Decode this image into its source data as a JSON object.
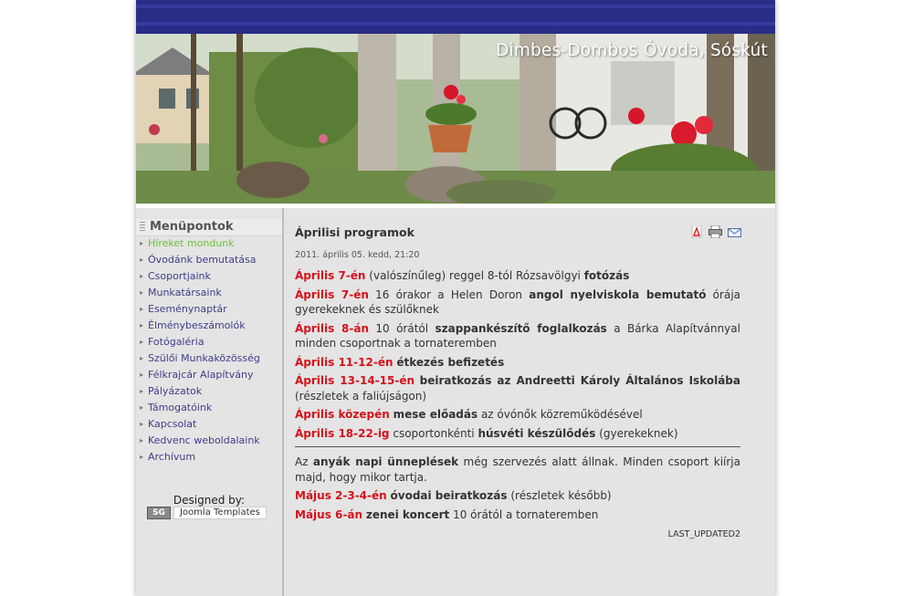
{
  "header": {
    "site_title": "Dimbes-Dombos Óvoda, Sóskút"
  },
  "sidebar": {
    "title": "Menüpontok",
    "items": [
      {
        "label": "Híreket mondunk",
        "active": true
      },
      {
        "label": "Óvodánk bemutatása"
      },
      {
        "label": "Csoportjaink"
      },
      {
        "label": "Munkatársaink"
      },
      {
        "label": "Eseménynaptár"
      },
      {
        "label": "Élménybeszámolók"
      },
      {
        "label": "Fotógaléria"
      },
      {
        "label": "Szülői Munkaközösség"
      },
      {
        "label": "Félkrajcár Alapítvány"
      },
      {
        "label": "Pályázatok"
      },
      {
        "label": "Támogatóink"
      },
      {
        "label": "Kapcsolat"
      },
      {
        "label": "Kedvenc weboldalaink"
      },
      {
        "label": "Archívum"
      }
    ],
    "designed_by": "Designed by:",
    "badge_logo": "SG",
    "badge_label": "Joomla Templates"
  },
  "article": {
    "title": "Áprilisi programok",
    "date": "2011. április 05. kedd, 21:20",
    "icons": [
      "pdf-icon",
      "print-icon",
      "email-icon"
    ],
    "p1": {
      "a": "Április 7-én",
      "b": " (valószínűleg) reggel 8-tól Rózsavölgyi ",
      "c": "fotózás"
    },
    "p2": {
      "a": "Április 7-én",
      "b": " 16 órakor a Helen Doron ",
      "c": "angol nyelviskola bemutató",
      "d": " órája gyerekeknek és szülőknek"
    },
    "p3": {
      "a": "Április 8-án",
      "b": " 10 órától ",
      "c": "szappankészítő foglalkozás",
      "d": " a Bárka Alapítvánnyal minden csoportnak a tornateremben"
    },
    "p4": {
      "a": "Április 11-12-én",
      "b": " ",
      "c": "étkezés befizetés"
    },
    "p5": {
      "a": "Április 13-14-15-én",
      "b": " ",
      "c": "beiratkozás az Andreetti Károly Általános Iskolába",
      "d": " (részletek a faliújságon)"
    },
    "p6": {
      "a": "Április közepén",
      "b": " ",
      "c": "mese előadás",
      "d": " az óvónők közreműködésével"
    },
    "p7": {
      "a": "Április 18-22-ig",
      "b": " csoportonkénti ",
      "c": "húsvéti készülődés",
      "d": " (gyerekeknek)"
    },
    "p8": {
      "a": "Az ",
      "b": "anyák napi ünneplések",
      "c": " még szervezés alatt állnak. Minden csoport kiírja majd, hogy mikor tartja."
    },
    "p9": {
      "a": "Május 2-3-4-én",
      "b": " ",
      "c": "óvodai beiratkozás",
      "d": " (részletek később)"
    },
    "p10": {
      "a": "Május 6-án",
      "b": " ",
      "c": "zenei koncert",
      "d": " 10 órától a tornateremben"
    },
    "last_updated": "LAST_UPDATED2"
  },
  "colors": {
    "topbar": "#2a2d86",
    "red_text": "#d6111b",
    "active_menu": "#6cc23a",
    "menu_link": "#3d3d8a",
    "background": "#e4e4e4"
  }
}
